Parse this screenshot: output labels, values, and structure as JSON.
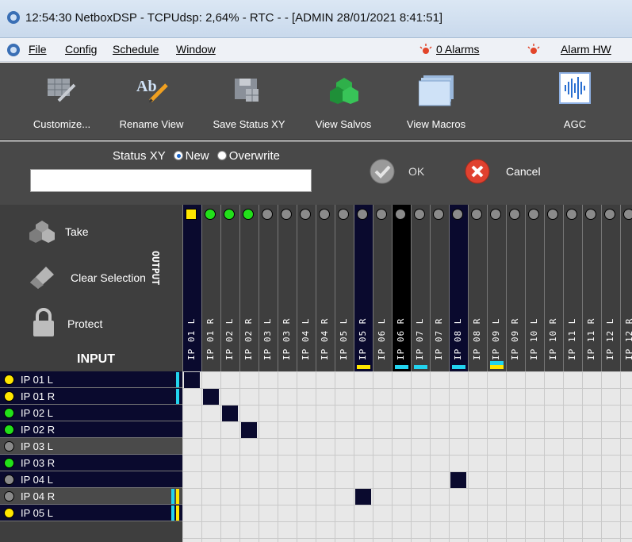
{
  "title": {
    "icon": "netbox-app-icon",
    "text": "12:54:30  NetboxDSP - TCPUdsp: 2,64% -  RTC  -  - [ADMIN  28/01/2021 8:41:51]"
  },
  "menu": {
    "items": [
      "File",
      "Config",
      "Schedule",
      "Window"
    ],
    "alarms": "0 Alarms",
    "alarm_hw": "Alarm HW"
  },
  "toolbar": {
    "customize": "Customize...",
    "rename": "Rename View",
    "save_status": "Save Status XY",
    "salvos": "View Salvos",
    "macros": "View Macros",
    "agc": "AGC"
  },
  "status": {
    "label": "Status XY",
    "opt_new": "New",
    "opt_overwrite": "Overwrite",
    "selected": "New",
    "input_value": "",
    "ok": "OK",
    "cancel": "Cancel"
  },
  "panel": {
    "take": "Take",
    "clear": "Clear Selection",
    "protect": "Protect",
    "output": "OUTPUT",
    "input": "INPUT"
  },
  "colors": {
    "selected_col": "#0a0a2e",
    "yellow": "#ffe600",
    "green": "#22e01a",
    "gray_lamp": "#8a8a8a",
    "cyan": "#22d3ee"
  },
  "outputs": [
    {
      "label": "IP 01 L",
      "lamp": "yellow-square",
      "active": true,
      "bar": ""
    },
    {
      "label": "IP 01 R",
      "lamp": "green",
      "active": false,
      "bar": ""
    },
    {
      "label": "IP 02 L",
      "lamp": "green",
      "active": false,
      "bar": ""
    },
    {
      "label": "IP 02 R",
      "lamp": "green",
      "active": false,
      "bar": ""
    },
    {
      "label": "IP 03 L",
      "lamp": "gray",
      "active": false,
      "bar": ""
    },
    {
      "label": "IP 03 R",
      "lamp": "gray",
      "active": false,
      "bar": ""
    },
    {
      "label": "IP 04 L",
      "lamp": "gray",
      "active": false,
      "bar": ""
    },
    {
      "label": "IP 04 R",
      "lamp": "gray",
      "active": false,
      "bar": ""
    },
    {
      "label": "IP 05 L",
      "lamp": "gray",
      "active": false,
      "bar": ""
    },
    {
      "label": "IP 05 R",
      "lamp": "gray",
      "active": true,
      "bar": "yellow"
    },
    {
      "label": "IP 06 L",
      "lamp": "gray",
      "active": false,
      "bar": ""
    },
    {
      "label": "IP 06 R",
      "lamp": "gray",
      "active": true,
      "bar": "cyan",
      "black": true
    },
    {
      "label": "IP 07 L",
      "lamp": "gray",
      "active": false,
      "bar": "cyan"
    },
    {
      "label": "IP 07 R",
      "lamp": "gray",
      "active": false,
      "bar": ""
    },
    {
      "label": "IP 08 L",
      "lamp": "gray",
      "active": true,
      "bar": "cyan"
    },
    {
      "label": "IP 08 R",
      "lamp": "gray",
      "active": false,
      "bar": ""
    },
    {
      "label": "IP 09 L",
      "lamp": "gray",
      "active": false,
      "bar": "cyan-yellow"
    },
    {
      "label": "IP 09 R",
      "lamp": "gray",
      "active": false,
      "bar": ""
    },
    {
      "label": "IP 10 L",
      "lamp": "gray",
      "active": false,
      "bar": ""
    },
    {
      "label": "IP 10 R",
      "lamp": "gray",
      "active": false,
      "bar": ""
    },
    {
      "label": "IP 11 L",
      "lamp": "gray",
      "active": false,
      "bar": ""
    },
    {
      "label": "IP 11 R",
      "lamp": "gray",
      "active": false,
      "bar": ""
    },
    {
      "label": "IP 12 L",
      "lamp": "gray",
      "active": false,
      "bar": ""
    },
    {
      "label": "IP 12 R",
      "lamp": "gray",
      "active": false,
      "bar": ""
    }
  ],
  "inputs": [
    {
      "label": "IP 01 L",
      "lamp": "yellow",
      "active": true,
      "ind": [
        "cyan"
      ]
    },
    {
      "label": "IP 01 R",
      "lamp": "yellow",
      "active": true,
      "ind": [
        "cyan"
      ]
    },
    {
      "label": "IP 02 L",
      "lamp": "green",
      "active": true,
      "ind": []
    },
    {
      "label": "IP 02 R",
      "lamp": "green",
      "active": true,
      "ind": []
    },
    {
      "label": "IP 03 L",
      "lamp": "gray",
      "active": false,
      "ind": []
    },
    {
      "label": "IP 03 R",
      "lamp": "green",
      "active": true,
      "ind": []
    },
    {
      "label": "IP 04 L",
      "lamp": "gray",
      "active": true,
      "ind": []
    },
    {
      "label": "IP 04 R",
      "lamp": "gray",
      "active": false,
      "ind": [
        "cyan",
        "yellow"
      ]
    },
    {
      "label": "IP 05 L",
      "lamp": "yellow",
      "active": true,
      "ind": [
        "cyan",
        "yellow"
      ]
    }
  ],
  "crosspoints": [
    [
      0,
      0
    ],
    [
      1,
      1
    ],
    [
      2,
      2
    ],
    [
      3,
      3
    ],
    [
      6,
      14
    ],
    [
      7,
      9
    ]
  ]
}
